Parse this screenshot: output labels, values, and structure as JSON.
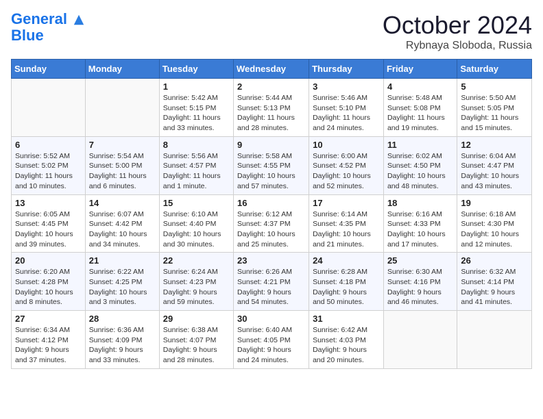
{
  "header": {
    "logo_line1": "General",
    "logo_line2": "Blue",
    "month_title": "October 2024",
    "location": "Rybnaya Sloboda, Russia"
  },
  "weekdays": [
    "Sunday",
    "Monday",
    "Tuesday",
    "Wednesday",
    "Thursday",
    "Friday",
    "Saturday"
  ],
  "weeks": [
    [
      {
        "day": "",
        "info": ""
      },
      {
        "day": "",
        "info": ""
      },
      {
        "day": "1",
        "info": "Sunrise: 5:42 AM\nSunset: 5:15 PM\nDaylight: 11 hours and 33 minutes."
      },
      {
        "day": "2",
        "info": "Sunrise: 5:44 AM\nSunset: 5:13 PM\nDaylight: 11 hours and 28 minutes."
      },
      {
        "day": "3",
        "info": "Sunrise: 5:46 AM\nSunset: 5:10 PM\nDaylight: 11 hours and 24 minutes."
      },
      {
        "day": "4",
        "info": "Sunrise: 5:48 AM\nSunset: 5:08 PM\nDaylight: 11 hours and 19 minutes."
      },
      {
        "day": "5",
        "info": "Sunrise: 5:50 AM\nSunset: 5:05 PM\nDaylight: 11 hours and 15 minutes."
      }
    ],
    [
      {
        "day": "6",
        "info": "Sunrise: 5:52 AM\nSunset: 5:02 PM\nDaylight: 11 hours and 10 minutes."
      },
      {
        "day": "7",
        "info": "Sunrise: 5:54 AM\nSunset: 5:00 PM\nDaylight: 11 hours and 6 minutes."
      },
      {
        "day": "8",
        "info": "Sunrise: 5:56 AM\nSunset: 4:57 PM\nDaylight: 11 hours and 1 minute."
      },
      {
        "day": "9",
        "info": "Sunrise: 5:58 AM\nSunset: 4:55 PM\nDaylight: 10 hours and 57 minutes."
      },
      {
        "day": "10",
        "info": "Sunrise: 6:00 AM\nSunset: 4:52 PM\nDaylight: 10 hours and 52 minutes."
      },
      {
        "day": "11",
        "info": "Sunrise: 6:02 AM\nSunset: 4:50 PM\nDaylight: 10 hours and 48 minutes."
      },
      {
        "day": "12",
        "info": "Sunrise: 6:04 AM\nSunset: 4:47 PM\nDaylight: 10 hours and 43 minutes."
      }
    ],
    [
      {
        "day": "13",
        "info": "Sunrise: 6:05 AM\nSunset: 4:45 PM\nDaylight: 10 hours and 39 minutes."
      },
      {
        "day": "14",
        "info": "Sunrise: 6:07 AM\nSunset: 4:42 PM\nDaylight: 10 hours and 34 minutes."
      },
      {
        "day": "15",
        "info": "Sunrise: 6:10 AM\nSunset: 4:40 PM\nDaylight: 10 hours and 30 minutes."
      },
      {
        "day": "16",
        "info": "Sunrise: 6:12 AM\nSunset: 4:37 PM\nDaylight: 10 hours and 25 minutes."
      },
      {
        "day": "17",
        "info": "Sunrise: 6:14 AM\nSunset: 4:35 PM\nDaylight: 10 hours and 21 minutes."
      },
      {
        "day": "18",
        "info": "Sunrise: 6:16 AM\nSunset: 4:33 PM\nDaylight: 10 hours and 17 minutes."
      },
      {
        "day": "19",
        "info": "Sunrise: 6:18 AM\nSunset: 4:30 PM\nDaylight: 10 hours and 12 minutes."
      }
    ],
    [
      {
        "day": "20",
        "info": "Sunrise: 6:20 AM\nSunset: 4:28 PM\nDaylight: 10 hours and 8 minutes."
      },
      {
        "day": "21",
        "info": "Sunrise: 6:22 AM\nSunset: 4:25 PM\nDaylight: 10 hours and 3 minutes."
      },
      {
        "day": "22",
        "info": "Sunrise: 6:24 AM\nSunset: 4:23 PM\nDaylight: 9 hours and 59 minutes."
      },
      {
        "day": "23",
        "info": "Sunrise: 6:26 AM\nSunset: 4:21 PM\nDaylight: 9 hours and 54 minutes."
      },
      {
        "day": "24",
        "info": "Sunrise: 6:28 AM\nSunset: 4:18 PM\nDaylight: 9 hours and 50 minutes."
      },
      {
        "day": "25",
        "info": "Sunrise: 6:30 AM\nSunset: 4:16 PM\nDaylight: 9 hours and 46 minutes."
      },
      {
        "day": "26",
        "info": "Sunrise: 6:32 AM\nSunset: 4:14 PM\nDaylight: 9 hours and 41 minutes."
      }
    ],
    [
      {
        "day": "27",
        "info": "Sunrise: 6:34 AM\nSunset: 4:12 PM\nDaylight: 9 hours and 37 minutes."
      },
      {
        "day": "28",
        "info": "Sunrise: 6:36 AM\nSunset: 4:09 PM\nDaylight: 9 hours and 33 minutes."
      },
      {
        "day": "29",
        "info": "Sunrise: 6:38 AM\nSunset: 4:07 PM\nDaylight: 9 hours and 28 minutes."
      },
      {
        "day": "30",
        "info": "Sunrise: 6:40 AM\nSunset: 4:05 PM\nDaylight: 9 hours and 24 minutes."
      },
      {
        "day": "31",
        "info": "Sunrise: 6:42 AM\nSunset: 4:03 PM\nDaylight: 9 hours and 20 minutes."
      },
      {
        "day": "",
        "info": ""
      },
      {
        "day": "",
        "info": ""
      }
    ]
  ]
}
